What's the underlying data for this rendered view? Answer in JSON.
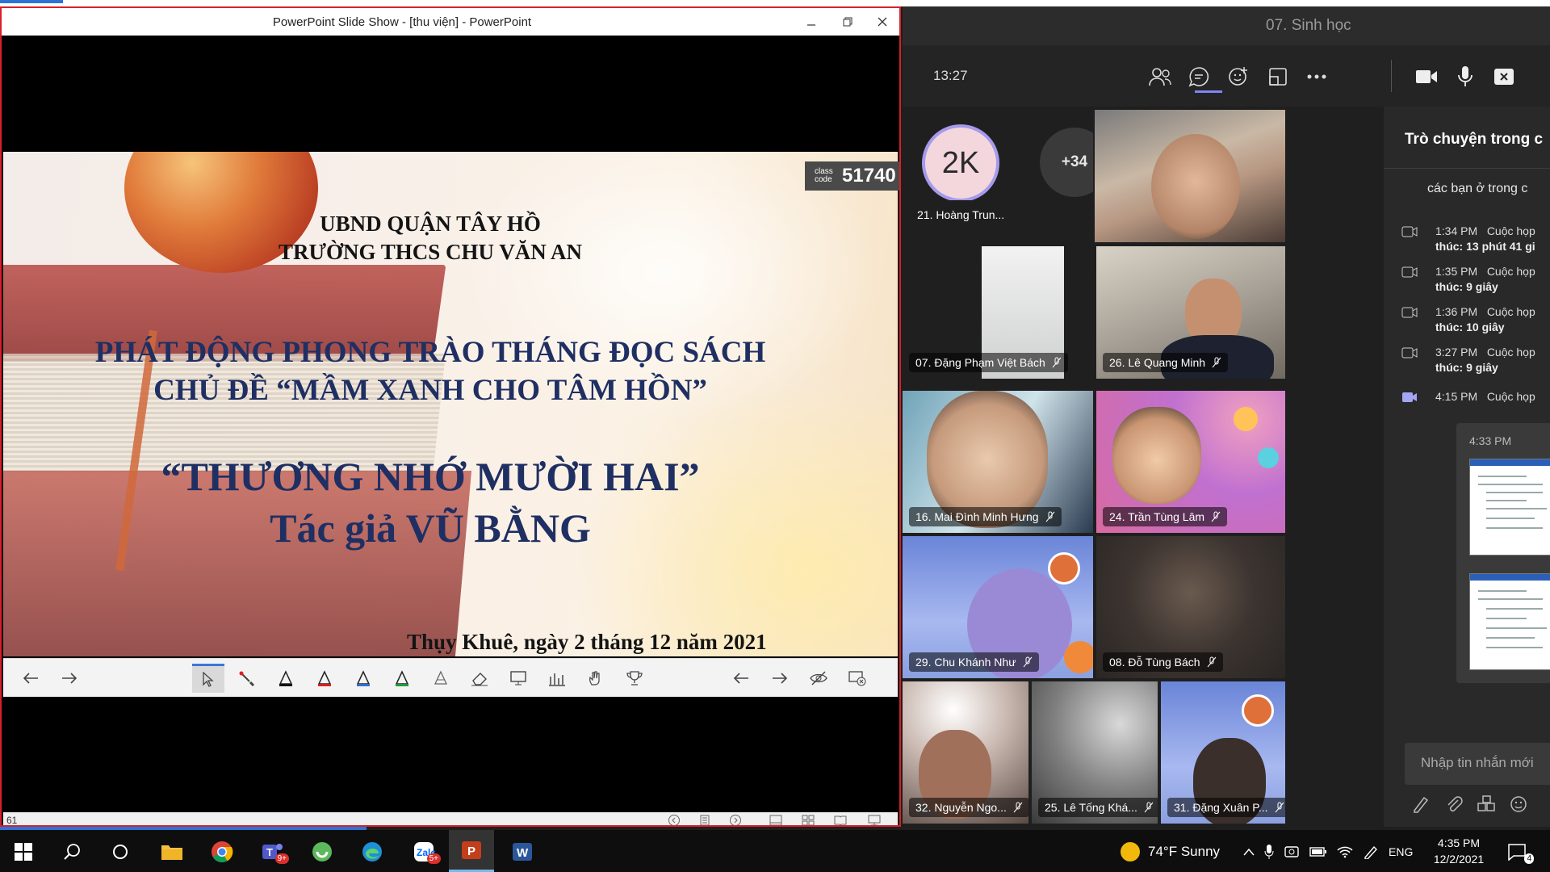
{
  "ppt": {
    "window_title": "PowerPoint Slide Show  -  [thu viện] - PowerPoint",
    "class_code_label": "class code",
    "class_code": "51740",
    "slide": {
      "line1": "UBND QUẬN TÂY HỒ",
      "line2": "TRƯỜNG THCS CHU VĂN AN",
      "line3": "PHÁT ĐỘNG PHONG TRÀO THÁNG ĐỌC SÁCH",
      "line4": "CHỦ ĐỀ “MẦM XANH CHO TÂM HỒN”",
      "line5": "“THƯƠNG NHỚ MƯỜI HAI”",
      "line6": "Tác giả VŨ BẰNG",
      "footer": "Thụy Khuê, ngày 2 tháng 12 năm 2021"
    },
    "status_slide": "61"
  },
  "teams": {
    "meeting_title": "07. Sinh học",
    "time": "13:27",
    "avatar_initials": "2K",
    "more_count": "+34",
    "participants": [
      {
        "name": "21. Hoàng Trun..."
      },
      {
        "name": "07. Đặng Phạm Việt Bách"
      },
      {
        "name": "26. Lê Quang Minh"
      },
      {
        "name": "16. Mai Đình Minh Hưng"
      },
      {
        "name": "24. Trần Tùng Lâm"
      },
      {
        "name": "29. Chu Khánh Như"
      },
      {
        "name": "08. Đỗ Tùng Bách"
      },
      {
        "name": "32. Nguyễn Ngo..."
      },
      {
        "name": "25. Lê Tống Khá..."
      },
      {
        "name": "31. Đặng Xuân P..."
      }
    ],
    "chat": {
      "header": "Trò chuyện trong c",
      "first_message": "các bạn ở trong c",
      "events": [
        {
          "time": "1:34 PM",
          "text": "Cuộc họp",
          "detail": "thúc: 13 phút 41 gi"
        },
        {
          "time": "1:35 PM",
          "text": "Cuộc họp",
          "detail": "thúc: 9 giây"
        },
        {
          "time": "1:36 PM",
          "text": "Cuộc họp",
          "detail": "thúc: 10 giây"
        },
        {
          "time": "3:27 PM",
          "text": "Cuộc họp",
          "detail": "thúc: 9 giây"
        },
        {
          "time": "4:15 PM",
          "text": "Cuộc họp",
          "detail": ""
        }
      ],
      "card_time": "4:33 PM",
      "input_placeholder": "Nhập tin nhắn mới"
    }
  },
  "taskbar": {
    "teams_badge": "9+",
    "zalo_badge": "5+",
    "weather": "74°F  Sunny",
    "language": "ENG",
    "clock_time": "4:35 PM",
    "clock_date": "12/2/2021",
    "notif_count": "4"
  },
  "colors": {
    "ppt_border": "#d8202a",
    "teams_accent": "#7f85f5",
    "slide_title_blue": "#1f2f63",
    "taskbar_bg": "#0e0e0e"
  }
}
